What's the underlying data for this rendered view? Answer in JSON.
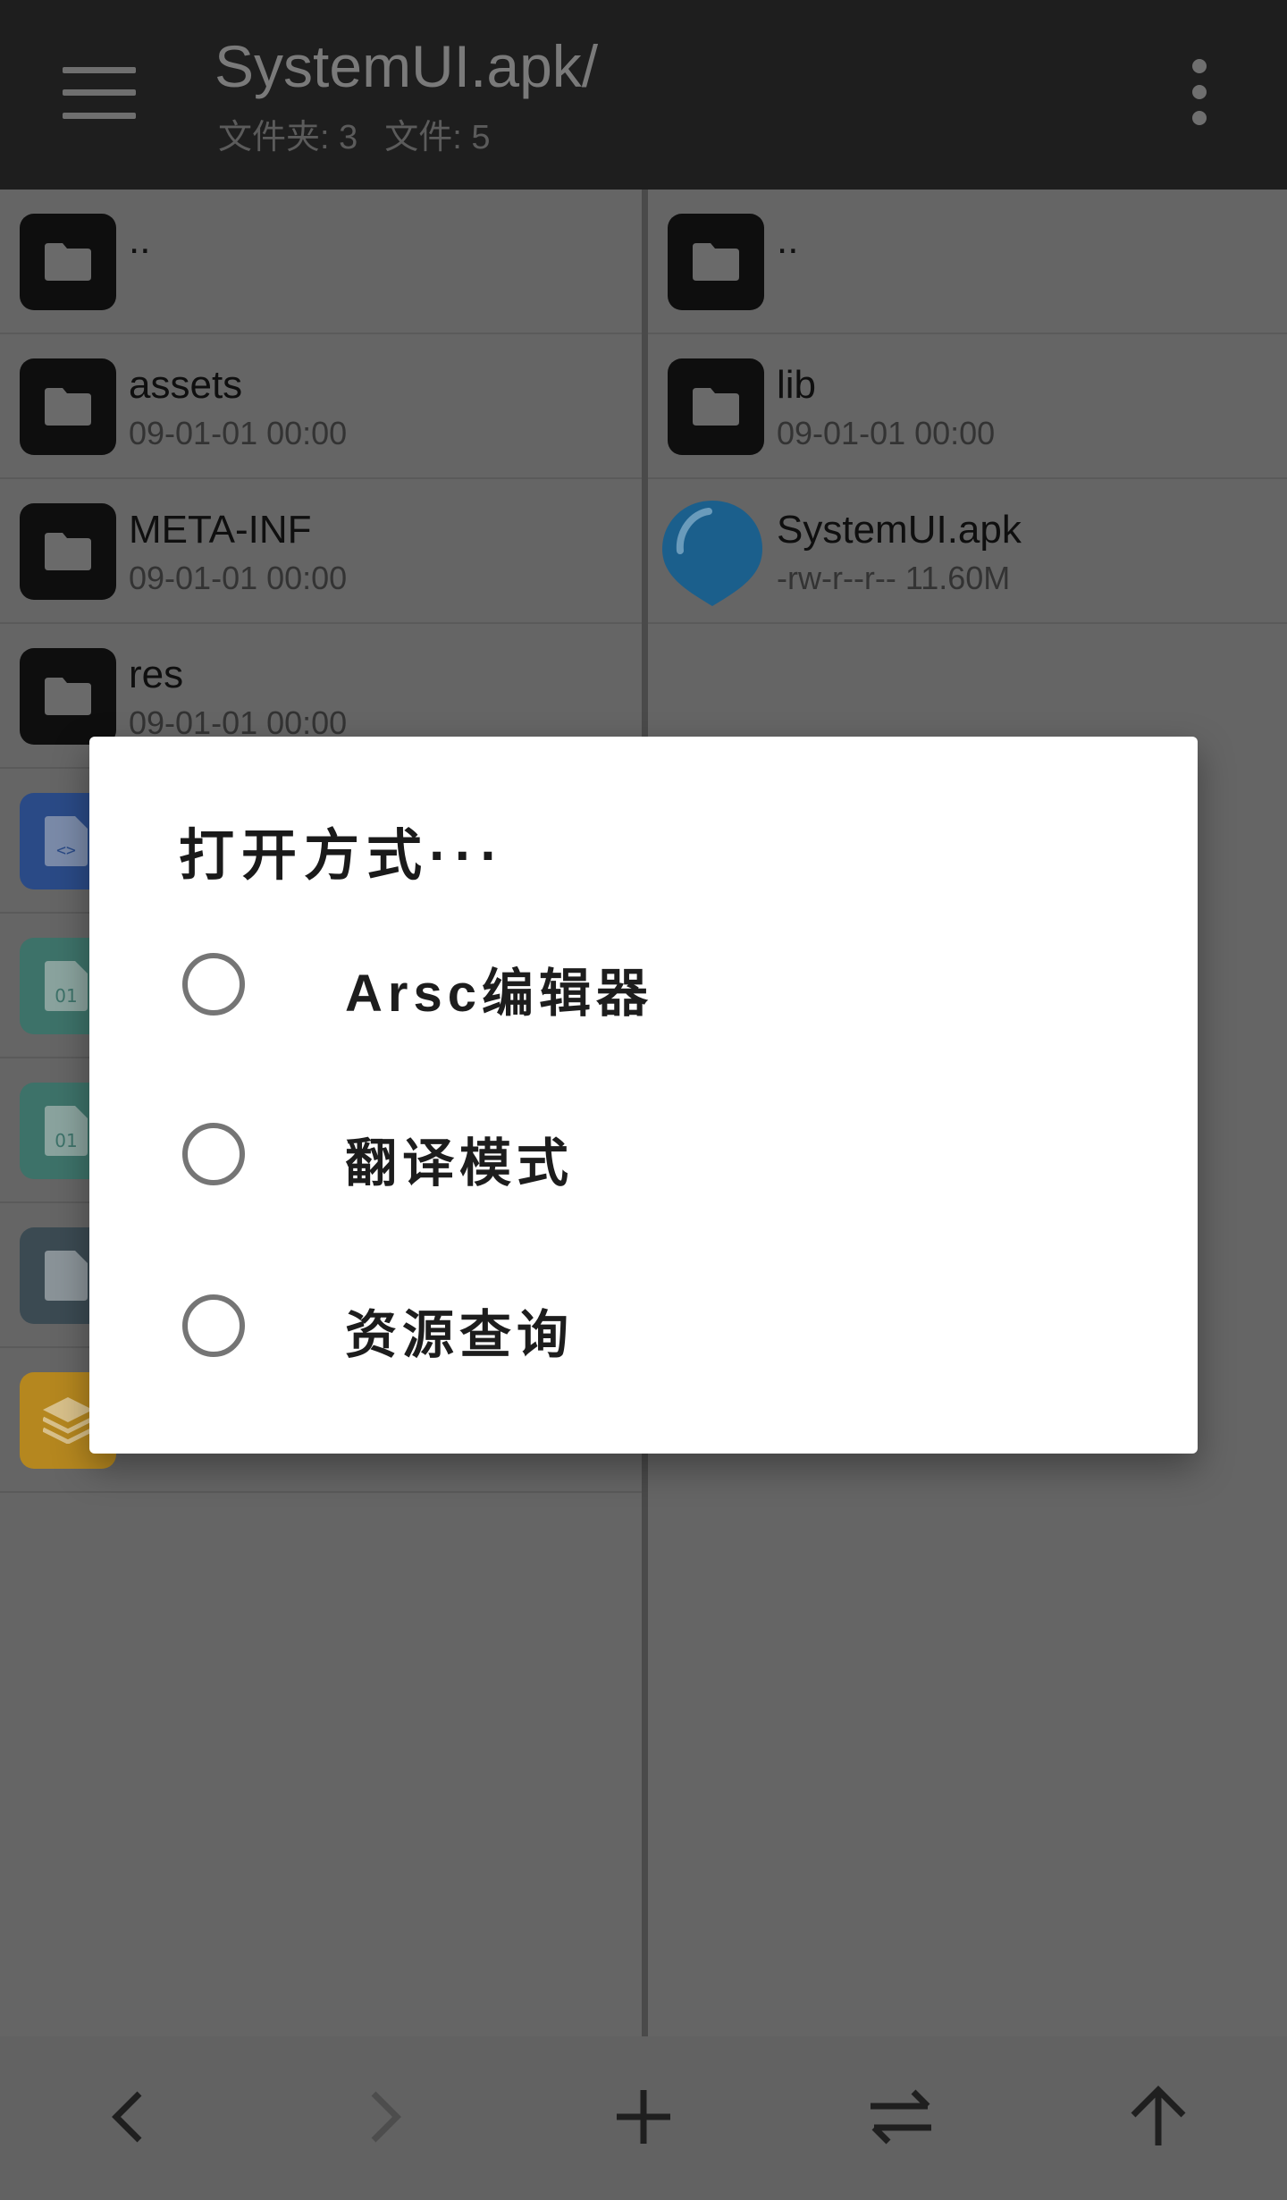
{
  "appbar": {
    "title": "SystemUI.apk/",
    "folders_count": "文件夹: 3",
    "files_count": "文件: 5"
  },
  "left_pane": {
    "rows": [
      {
        "name": "..",
        "meta": "",
        "icon": "folder-icon"
      },
      {
        "name": "assets",
        "meta": "09-01-01 00:00",
        "icon": "folder-icon"
      },
      {
        "name": "META-INF",
        "meta": "09-01-01 00:00",
        "icon": "folder-icon"
      },
      {
        "name": "res",
        "meta": "09-01-01 00:00",
        "icon": "folder-icon"
      },
      {
        "icon": "code-file-icon",
        "color": "#2a4a86"
      },
      {
        "icon": "binary-file-icon",
        "color": "#3d7269"
      },
      {
        "icon": "binary-file-icon",
        "color": "#3d7269"
      },
      {
        "icon": "file-icon",
        "color": "#3b4a52"
      },
      {
        "icon": "layers-icon",
        "color": "#b5871f"
      }
    ]
  },
  "right_pane": {
    "rows": [
      {
        "name": "..",
        "meta": "",
        "icon": "folder-icon"
      },
      {
        "name": "lib",
        "meta": "09-01-01 00:00",
        "icon": "folder-icon"
      },
      {
        "name": "SystemUI.apk",
        "meta": "-rw-r--r--  11.60M",
        "icon": "apk-balloon-icon",
        "color": "#1b5f8c"
      }
    ]
  },
  "dialog": {
    "title": "打开方式···",
    "options": [
      "Arsc编辑器",
      "翻译模式",
      "资源查询"
    ]
  },
  "bottombar": {
    "buttons": [
      "back-icon",
      "forward-icon",
      "add-icon",
      "swap-icon",
      "up-icon"
    ]
  }
}
